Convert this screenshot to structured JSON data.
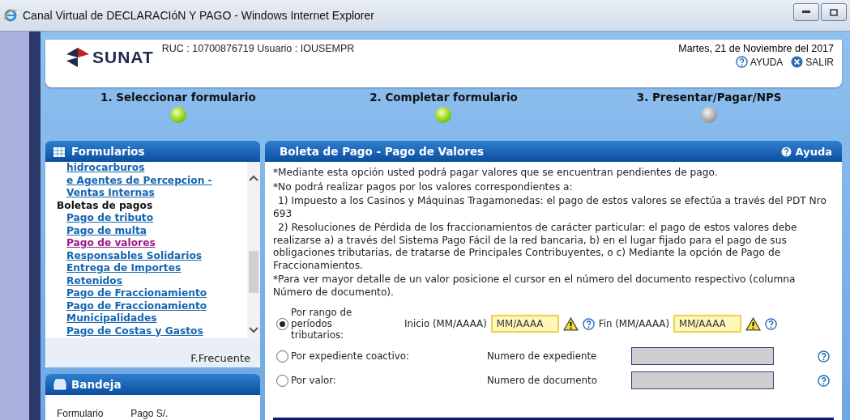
{
  "window": {
    "title": "Canal Virtual de DECLARACIóN Y PAGO - Windows Internet Explorer"
  },
  "header": {
    "logo": "SUNAT",
    "user_line": "RUC : 10700876719 Usuario : IOUSEMPR",
    "date": "Martes, 21 de Noviembre del 2017",
    "links": [
      "AYUDA",
      "SALIR"
    ]
  },
  "steps": [
    {
      "label": "1. Seleccionar formulario",
      "done": true
    },
    {
      "label": "2. Completar formulario",
      "done": true
    },
    {
      "label": "3. Presentar/Pagar/NPS",
      "done": false
    }
  ],
  "formularios": {
    "title": "Formularios",
    "items": [
      {
        "text": "hidrocarburos",
        "kind": "link",
        "selected": false
      },
      {
        "text": "e Agentes de Percepcion -",
        "kind": "link",
        "selected": false
      },
      {
        "text": "Ventas Internas",
        "kind": "link",
        "selected": false
      },
      {
        "text": "Boletas de pagos",
        "kind": "heading"
      },
      {
        "text": "Pago de tributo",
        "kind": "link",
        "selected": false
      },
      {
        "text": "Pago de multa",
        "kind": "link",
        "selected": false
      },
      {
        "text": "Pago de valores",
        "kind": "link",
        "selected": true
      },
      {
        "text": "Responsables Solidarios",
        "kind": "link",
        "selected": false
      },
      {
        "text": "Entrega de Importes",
        "kind": "link",
        "selected": false
      },
      {
        "text": "Retenidos",
        "kind": "link",
        "selected": false
      },
      {
        "text": "Pago de Fraccionamiento",
        "kind": "link",
        "selected": false
      },
      {
        "text": "Pago de Fraccionamiento",
        "kind": "link",
        "selected": false
      },
      {
        "text": "Municipalidades",
        "kind": "link",
        "selected": false
      },
      {
        "text": "Pago de Costas y Gastos",
        "kind": "link",
        "selected": false
      }
    ],
    "footer": "F.Frecuente"
  },
  "bandeja": {
    "title": "Bandeja",
    "columns": [
      "Formulario",
      "Pago S/."
    ]
  },
  "main": {
    "title": "Boleta de Pago - Pago de Valores",
    "help": "Ayuda",
    "notes": [
      {
        "text": "*Mediante esta opción usted podrá pagar valores que se encuentran pendientes de pago.",
        "kind": "note"
      },
      {
        "text": "*No podrá realizar pagos por los valores correspondientes a:",
        "kind": "note"
      },
      {
        "text": "1) Impuesto a los Casinos y Máquinas Tragamonedas: el pago de estos valores se efectúa a través del PDT Nro 693",
        "kind": "sub"
      },
      {
        "text": "2) Resoluciones de Pérdida de los fraccionamientos de carácter particular: el pago de estos valores debe realizarse a) a través del Sistema Pago Fácil de la red bancaria, b) en el lugar fijado para el pago de sus obligaciones tributarias, de tratarse de Principales Contribuyentes, o c) Mediante la opción de Pago de Fraccionamientos.",
        "kind": "sub"
      },
      {
        "text": "*Para ver mayor detalle de un valor posicione el cursor en el número del documento respectivo (columna Número de documento).",
        "kind": "note"
      }
    ],
    "options": [
      {
        "label": "Por rango de períodos tributarios:",
        "selected": true,
        "fields": [
          {
            "label": "Inicio (MM/AAAA)",
            "placeholder": "MM/AAAA",
            "disabled": false
          },
          {
            "label": "Fin (MM/AAAA)",
            "placeholder": "MM/AAAA",
            "disabled": false
          }
        ]
      },
      {
        "label": "Por expediente coactivo:",
        "selected": false,
        "fields": [
          {
            "label": "Numero de expediente",
            "disabled": true
          }
        ]
      },
      {
        "label": "Por valor:",
        "selected": false,
        "fields": [
          {
            "label": "Numero de documento",
            "disabled": true
          }
        ]
      }
    ]
  }
}
